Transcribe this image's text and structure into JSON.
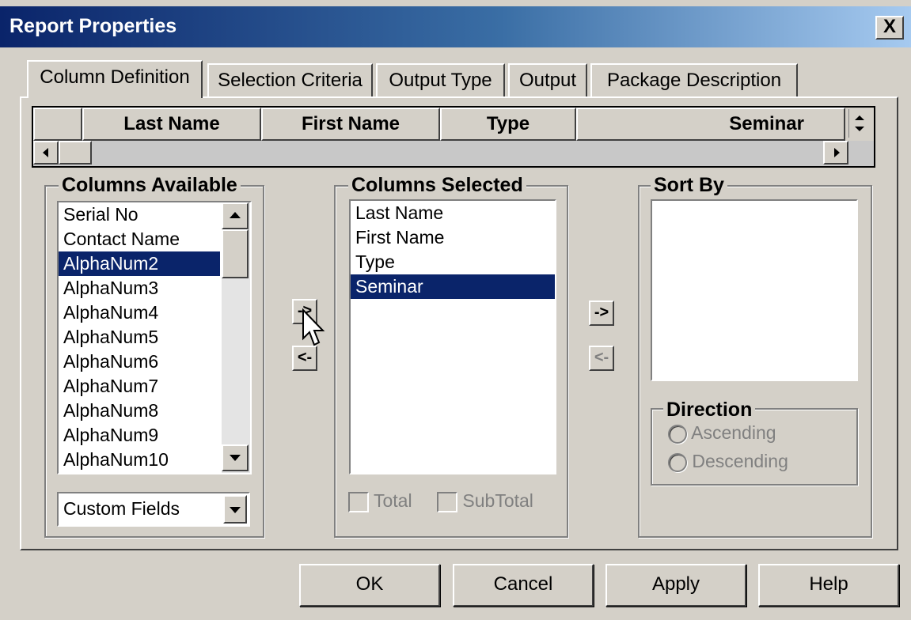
{
  "window": {
    "title": "Report Properties",
    "close_label": "X"
  },
  "tabs": [
    {
      "label": "Column Definition",
      "active": true
    },
    {
      "label": "Selection Criteria",
      "active": false
    },
    {
      "label": "Output Type",
      "active": false
    },
    {
      "label": "Output",
      "active": false
    },
    {
      "label": "Package Description",
      "active": false
    }
  ],
  "grid": {
    "columns": [
      "Last Name",
      "First Name",
      "Type",
      "Seminar"
    ]
  },
  "columns_available": {
    "title": "Columns Available",
    "items": [
      "Serial No",
      "Contact Name",
      "AlphaNum2",
      "AlphaNum3",
      "AlphaNum4",
      "AlphaNum5",
      "AlphaNum6",
      "AlphaNum7",
      "AlphaNum8",
      "AlphaNum9",
      "AlphaNum10"
    ],
    "selected": "AlphaNum2",
    "dropdown_value": "Custom Fields"
  },
  "move_buttons": {
    "add": "->",
    "remove": "<-"
  },
  "columns_selected": {
    "title": "Columns Selected",
    "items": [
      "Last Name",
      "First Name",
      "Type",
      "Seminar"
    ],
    "selected": "Seminar",
    "total_label": "Total",
    "subtotal_label": "SubTotal"
  },
  "sort_buttons": {
    "add": "->",
    "remove": "<-"
  },
  "sort_by": {
    "title": "Sort By",
    "items": [],
    "direction_title": "Direction",
    "ascending_label": "Ascending",
    "descending_label": "Descending"
  },
  "footer": {
    "ok": "OK",
    "cancel": "Cancel",
    "apply": "Apply",
    "help": "Help"
  },
  "colors": {
    "title_start": "#0a246a",
    "title_end": "#a6caf0",
    "selection": "#0a246a",
    "face": "#d4d0c8"
  }
}
